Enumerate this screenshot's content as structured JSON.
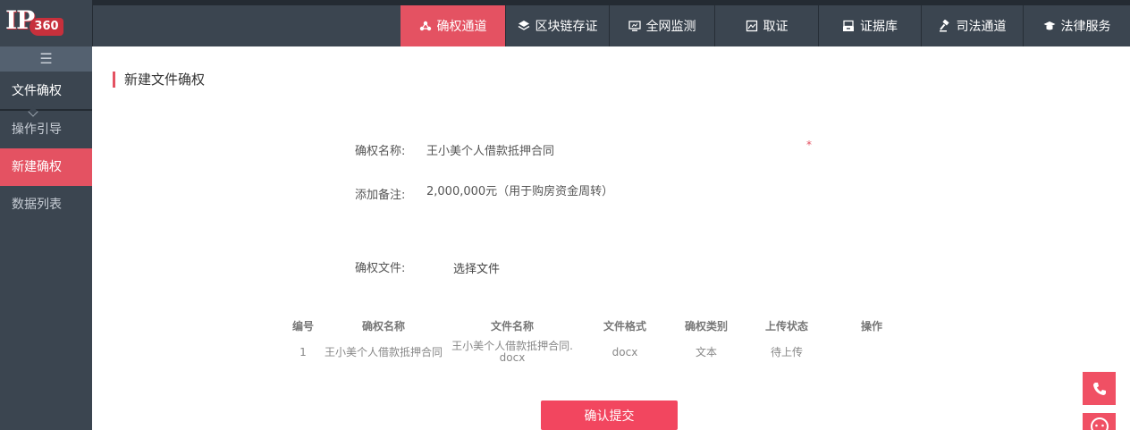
{
  "logo": {
    "ip": "IP",
    "num": "360"
  },
  "nav": [
    {
      "label": "确权通道",
      "icon": "badge-icon",
      "active": true
    },
    {
      "label": "区块链存证",
      "icon": "layers-icon",
      "active": false
    },
    {
      "label": "全网监测",
      "icon": "monitor-icon",
      "active": false
    },
    {
      "label": "取证",
      "icon": "image-icon",
      "active": false
    },
    {
      "label": "证据库",
      "icon": "archive-icon",
      "active": false
    },
    {
      "label": "司法通道",
      "icon": "gavel-icon",
      "active": false
    },
    {
      "label": "法律服务",
      "icon": "graduation-cap-icon",
      "active": false
    }
  ],
  "sidebar": {
    "toggle": "☰",
    "head": "文件确权",
    "items": [
      {
        "label": "操作引导",
        "active": false
      },
      {
        "label": "新建确权",
        "active": true
      },
      {
        "label": "数据列表",
        "active": false
      }
    ]
  },
  "page": {
    "title": "新建文件确权"
  },
  "form": {
    "name_label": "确权名称:",
    "name_value": "王小美个人借款抵押合同",
    "required_mark": "*",
    "remark_label": "添加备注:",
    "remark_value": "2,000,000元（用于购房资金周转）",
    "file_label": "确权文件:",
    "file_button": "选择文件"
  },
  "table": {
    "headers": [
      "编号",
      "确权名称",
      "文件名称",
      "文件格式",
      "确权类别",
      "上传状态",
      "操作"
    ],
    "rows": [
      [
        "1",
        "王小美个人借款抵押合同",
        "王小美个人借款抵押合同.docx",
        "docx",
        "文本",
        "待上传",
        ""
      ]
    ]
  },
  "submit_label": "确认提交",
  "colors": {
    "accent": "#e45262",
    "sidebar": "#3b4550",
    "submit": "#f2465f"
  }
}
